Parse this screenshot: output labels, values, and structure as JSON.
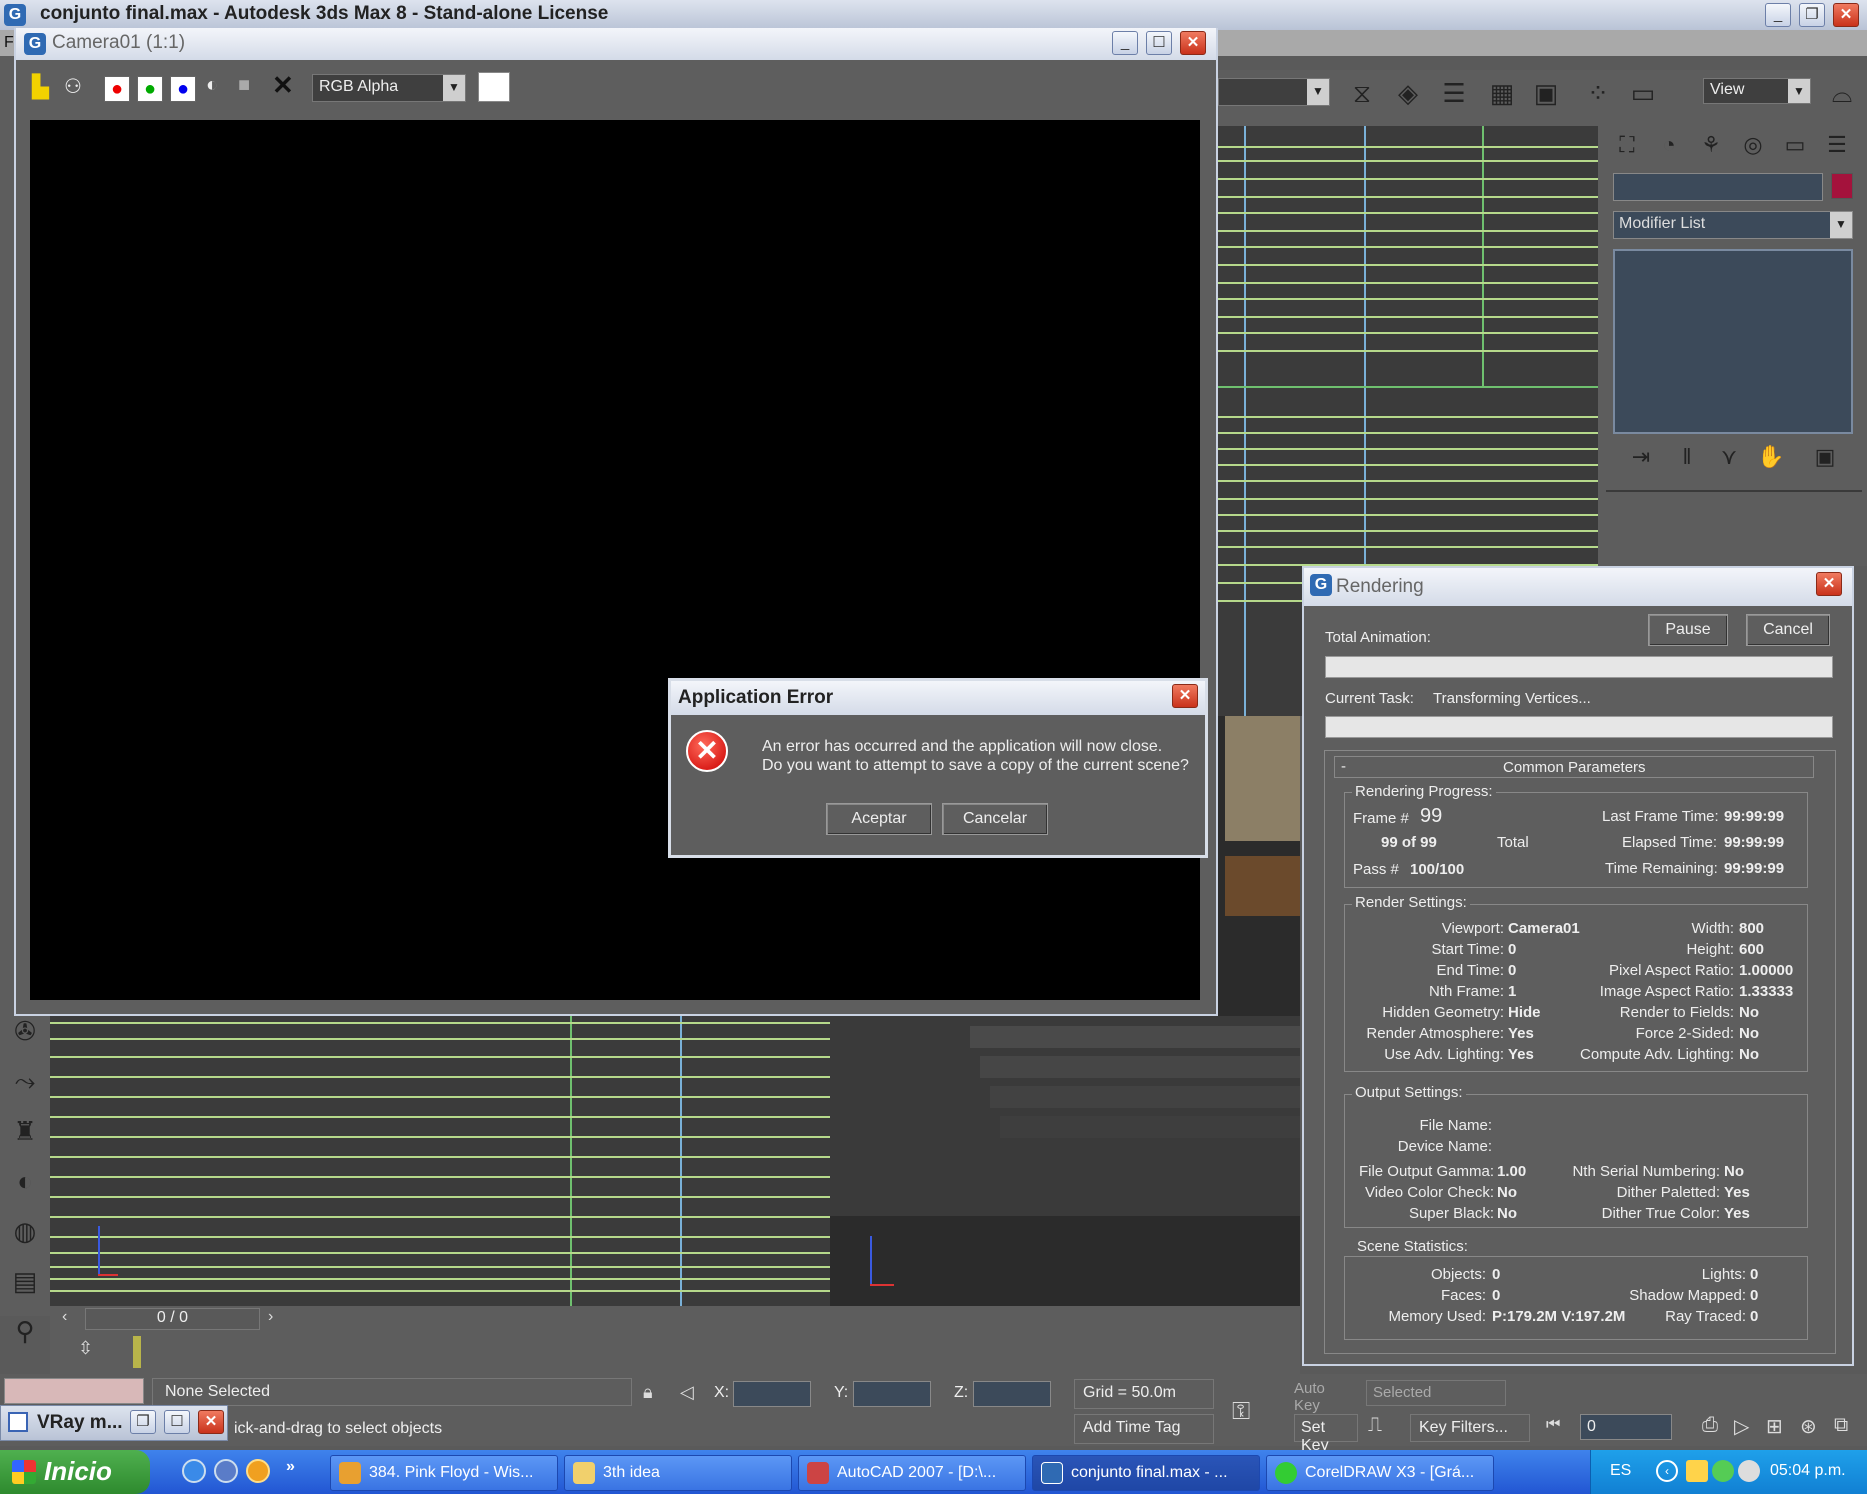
{
  "main_window": {
    "title": "conjunto final.max - Autodesk 3ds Max 8 - Stand-alone License",
    "menu_letter": "F",
    "view_dropdown": "View",
    "command_panel": {
      "modifier_list": "Modifier List"
    }
  },
  "camera_window": {
    "title": "Camera01 (1:1)",
    "channel_dropdown": "RGB Alpha"
  },
  "error_dialog": {
    "title": "Application Error",
    "message_line1": "An error has occurred and the application will now close.",
    "message_line2": "Do you want to attempt to save a copy of the current scene?",
    "ok_label": "Aceptar",
    "cancel_label": "Cancelar"
  },
  "rendering_dialog": {
    "title": "Rendering",
    "pause_label": "Pause",
    "cancel_label": "Cancel",
    "total_animation_label": "Total Animation:",
    "current_task_label": "Current Task:",
    "current_task_value": "Transforming Vertices...",
    "section_header": "Common Parameters",
    "section_toggle": "-",
    "progress": {
      "heading": "Rendering Progress:",
      "frame_label": "Frame #",
      "frame_value": "99",
      "of_text": "99 of 99",
      "total_label": "Total",
      "pass_label": "Pass #",
      "pass_value": "100/100",
      "last_frame_label": "Last Frame Time:",
      "last_frame_value": "99:99:99",
      "elapsed_label": "Elapsed Time:",
      "elapsed_value": "99:99:99",
      "remaining_label": "Time Remaining:",
      "remaining_value": "99:99:99"
    },
    "render_settings": {
      "heading": "Render Settings:",
      "left": [
        {
          "label": "Viewport:",
          "value": "Camera01"
        },
        {
          "label": "Start Time:",
          "value": "0"
        },
        {
          "label": "End Time:",
          "value": "0"
        },
        {
          "label": "Nth Frame:",
          "value": "1"
        },
        {
          "label": "Hidden Geometry:",
          "value": "Hide"
        },
        {
          "label": "Render Atmosphere:",
          "value": "Yes"
        },
        {
          "label": "Use Adv. Lighting:",
          "value": "Yes"
        }
      ],
      "right": [
        {
          "label": "Width:",
          "value": "800"
        },
        {
          "label": "Height:",
          "value": "600"
        },
        {
          "label": "Pixel Aspect Ratio:",
          "value": "1.00000"
        },
        {
          "label": "Image Aspect Ratio:",
          "value": "1.33333"
        },
        {
          "label": "Render to Fields:",
          "value": "No"
        },
        {
          "label": "Force 2-Sided:",
          "value": "No"
        },
        {
          "label": "Compute Adv. Lighting:",
          "value": "No"
        }
      ]
    },
    "output_settings": {
      "heading": "Output Settings:",
      "file_name_label": "File Name:",
      "device_name_label": "Device Name:",
      "left": [
        {
          "label": "File Output Gamma:",
          "value": "1.00"
        },
        {
          "label": "Video Color Check:",
          "value": "No"
        },
        {
          "label": "Super Black:",
          "value": "No"
        }
      ],
      "right": [
        {
          "label": "Nth Serial Numbering:",
          "value": "No"
        },
        {
          "label": "Dither Paletted:",
          "value": "Yes"
        },
        {
          "label": "Dither True Color:",
          "value": "Yes"
        }
      ]
    },
    "scene_statistics": {
      "heading": "Scene Statistics:",
      "left": [
        {
          "label": "Objects:",
          "value": "0"
        },
        {
          "label": "Faces:",
          "value": "0"
        },
        {
          "label": "Memory Used:",
          "value": "P:179.2M V:197.2M"
        }
      ],
      "right": [
        {
          "label": "Lights:",
          "value": "0"
        },
        {
          "label": "Shadow Mapped:",
          "value": "0"
        },
        {
          "label": "Ray Traced:",
          "value": "0"
        }
      ]
    }
  },
  "status": {
    "frame_counter": "0 / 0",
    "selection": "None Selected",
    "prompt": "ick-and-drag to select objects",
    "x_label": "X:",
    "y_label": "Y:",
    "z_label": "Z:",
    "grid": "Grid = 50.0m",
    "add_time_tag": "Add Time Tag",
    "set_key": "Set Key",
    "key_filters": "Key Filters...",
    "current_frame": "0",
    "auto_key": "Auto Key",
    "selected": "Selected"
  },
  "vray_mini": {
    "title": "VRay m..."
  },
  "taskbar": {
    "start_label": "Inicio",
    "buttons": [
      {
        "label": "384. Pink Floyd - Wis..."
      },
      {
        "label": "3th idea"
      },
      {
        "label": "AutoCAD 2007 - [D:\\..."
      },
      {
        "label": "conjunto final.max - ..."
      },
      {
        "label": "CorelDRAW X3 - [Grá..."
      }
    ],
    "language": "ES",
    "clock": "05:04 p.m."
  }
}
